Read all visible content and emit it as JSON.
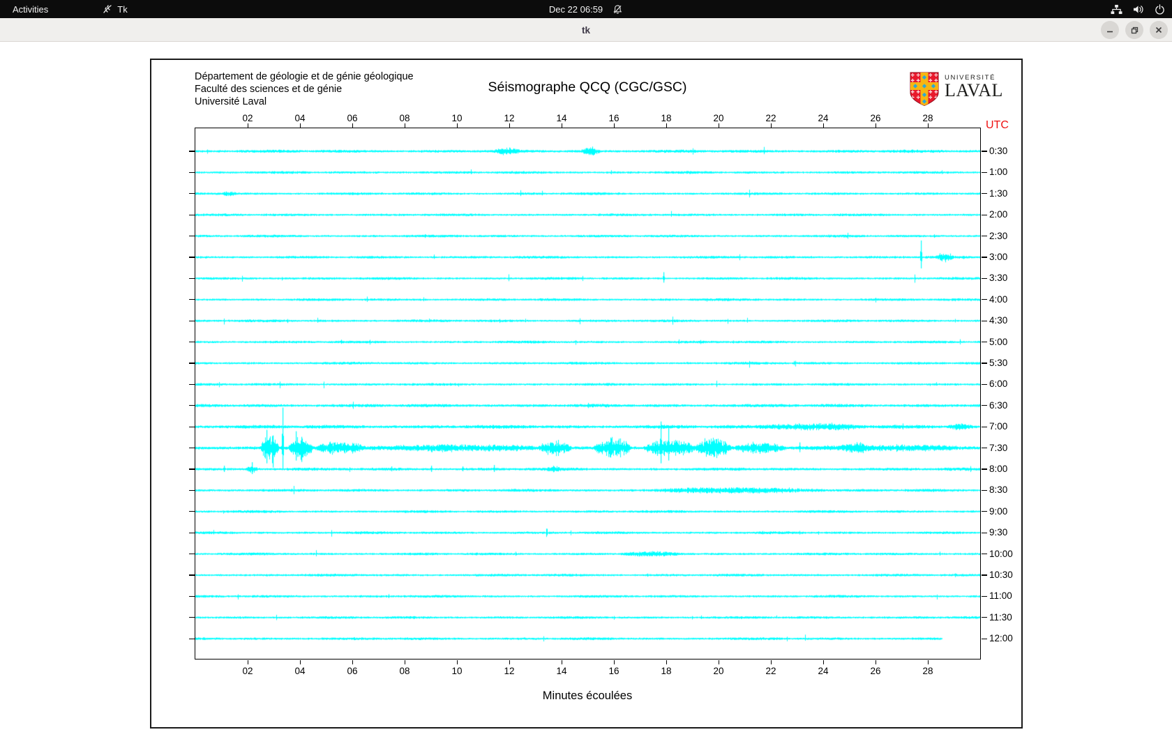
{
  "topbar": {
    "activities_label": "Activities",
    "app_name": "Tk",
    "clock": "Dec 22 06:59",
    "status_icons": [
      "notifications-disabled-icon",
      "network-icon",
      "volume-icon",
      "power-icon"
    ]
  },
  "titlebar": {
    "title": "tk",
    "controls": [
      "minimize",
      "maximize",
      "close"
    ]
  },
  "plot": {
    "header_lines": [
      "Département de géologie et de génie géologique",
      "Faculté des sciences et de génie",
      "Université Laval"
    ],
    "title": "Séismographe QCQ (CGC/GSC)",
    "logo": {
      "line1": "UNIVERSITÉ",
      "line2": "LAVAL"
    },
    "utc_label": "UTC",
    "xlabel": "Minutes écoulées",
    "colors": {
      "trace": "#00ffff",
      "utc": "#ee1111",
      "axis": "#000000",
      "shield_red": "#e8192c",
      "shield_gold": "#f7b512",
      "shield_blue": "#2ba8d8"
    }
  },
  "chart_data": {
    "type": "line",
    "variant": "helicorder-seismogram",
    "title": "Séismographe QCQ (CGC/GSC)",
    "xlabel": "Minutes écoulées",
    "x_range_minutes": [
      0,
      30
    ],
    "x_ticks": [
      "02",
      "04",
      "06",
      "08",
      "10",
      "12",
      "14",
      "16",
      "18",
      "20",
      "22",
      "24",
      "26",
      "28"
    ],
    "row_labels": [
      "0:30",
      "1:00",
      "1:30",
      "2:00",
      "2:30",
      "3:00",
      "3:30",
      "4:00",
      "4:30",
      "5:00",
      "5:30",
      "6:00",
      "6:30",
      "7:00",
      "7:30",
      "8:00",
      "8:30",
      "9:00",
      "9:30",
      "10:00",
      "10:30",
      "11:00",
      "11:30",
      "12:00"
    ],
    "utc_label": "UTC",
    "trace_color": "#00ffff",
    "base_amp_default": 1.3,
    "base_amp_overrides": {
      "0": 1.5,
      "12": 1.6,
      "13": 1.8,
      "14": 1.9,
      "15": 1.5,
      "16": 1.4
    },
    "row_end_overrides": {
      "23": 28.55
    },
    "events": [
      {
        "row": 0,
        "kind": "burst",
        "start": 11.4,
        "end": 12.4,
        "amp": 3
      },
      {
        "row": 0,
        "kind": "burst",
        "start": 14.7,
        "end": 15.5,
        "amp": 4.5
      },
      {
        "row": 2,
        "kind": "burst",
        "start": 1.0,
        "end": 1.6,
        "amp": 2.5
      },
      {
        "row": 5,
        "kind": "spike",
        "at": 27.72,
        "up": 24,
        "down": 16
      },
      {
        "row": 5,
        "kind": "burst",
        "start": 28.3,
        "end": 29.0,
        "amp": 4.5
      },
      {
        "row": 6,
        "kind": "spike",
        "at": 17.9,
        "up": 9,
        "down": 6
      },
      {
        "row": 13,
        "kind": "burst",
        "start": 21.4,
        "end": 25.8,
        "amp": 3.2
      },
      {
        "row": 13,
        "kind": "burst",
        "start": 28.7,
        "end": 29.7,
        "amp": 2.8
      },
      {
        "row": 14,
        "kind": "burst",
        "start": 2.5,
        "end": 3.2,
        "amp": 20
      },
      {
        "row": 14,
        "kind": "spike",
        "at": 2.72,
        "up": 26,
        "down": 22
      },
      {
        "row": 14,
        "kind": "spike",
        "at": 2.95,
        "up": 18,
        "down": 28
      },
      {
        "row": 14,
        "kind": "spike",
        "at": 3.32,
        "up": 58,
        "down": 30
      },
      {
        "row": 14,
        "kind": "spike",
        "at": 3.85,
        "up": 24,
        "down": 18
      },
      {
        "row": 14,
        "kind": "spike",
        "at": 4.05,
        "up": 16,
        "down": 20
      },
      {
        "row": 14,
        "kind": "burst",
        "start": 3.55,
        "end": 4.5,
        "amp": 15
      },
      {
        "row": 14,
        "kind": "burst",
        "start": 4.5,
        "end": 6.5,
        "amp": 7
      },
      {
        "row": 14,
        "kind": "burst",
        "start": 6.5,
        "end": 13.0,
        "amp": 3.5
      },
      {
        "row": 14,
        "kind": "burst",
        "start": 13.1,
        "end": 14.4,
        "amp": 9
      },
      {
        "row": 14,
        "kind": "burst",
        "start": 15.2,
        "end": 16.7,
        "amp": 12
      },
      {
        "row": 14,
        "kind": "spike",
        "at": 17.78,
        "up": 38,
        "down": 22
      },
      {
        "row": 14,
        "kind": "spike",
        "at": 18.08,
        "up": 30,
        "down": 18
      },
      {
        "row": 14,
        "kind": "burst",
        "start": 17.1,
        "end": 19.1,
        "amp": 10
      },
      {
        "row": 14,
        "kind": "burst",
        "start": 19.1,
        "end": 20.5,
        "amp": 13
      },
      {
        "row": 14,
        "kind": "burst",
        "start": 20.5,
        "end": 22.6,
        "amp": 6
      },
      {
        "row": 14,
        "kind": "spike",
        "at": 23.1,
        "up": 8,
        "down": 6
      },
      {
        "row": 14,
        "kind": "burst",
        "start": 24.8,
        "end": 25.7,
        "amp": 5
      },
      {
        "row": 14,
        "kind": "burst",
        "start": 22.6,
        "end": 30.0,
        "amp": 2.5
      },
      {
        "row": 15,
        "kind": "spike",
        "at": 1.1,
        "up": 5,
        "down": 4
      },
      {
        "row": 15,
        "kind": "spike",
        "at": 2.15,
        "up": 10,
        "down": 7
      },
      {
        "row": 15,
        "kind": "burst",
        "start": 1.9,
        "end": 2.4,
        "amp": 4
      },
      {
        "row": 15,
        "kind": "spike",
        "at": 7.5,
        "up": 4,
        "down": 3
      },
      {
        "row": 15,
        "kind": "spike",
        "at": 9.0,
        "up": 5,
        "down": 4
      },
      {
        "row": 15,
        "kind": "spike",
        "at": 10.2,
        "up": 4,
        "down": 3
      },
      {
        "row": 15,
        "kind": "spike",
        "at": 11.4,
        "up": 6,
        "down": 4
      },
      {
        "row": 15,
        "kind": "burst",
        "start": 13.4,
        "end": 14.0,
        "amp": 3
      },
      {
        "row": 16,
        "kind": "burst",
        "start": 17.0,
        "end": 24.2,
        "amp": 2.6
      },
      {
        "row": 19,
        "kind": "burst",
        "start": 16.2,
        "end": 18.6,
        "amp": 2.2
      }
    ]
  }
}
